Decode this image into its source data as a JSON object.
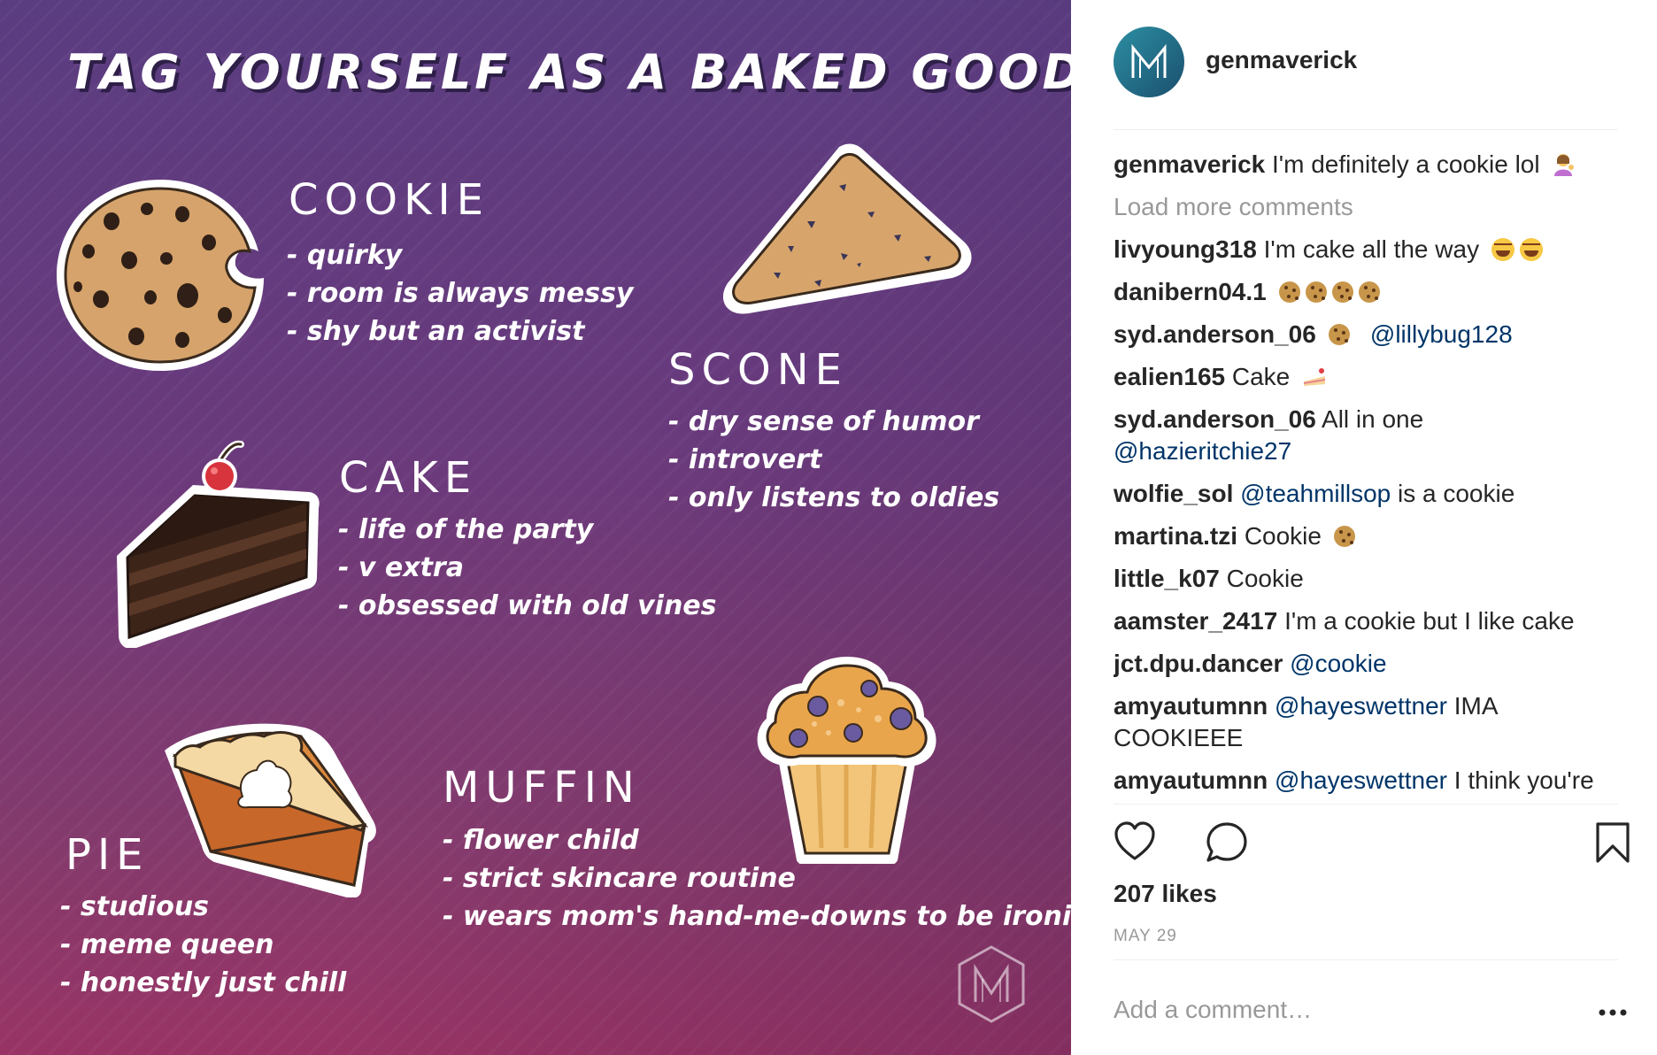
{
  "post": {
    "title": "TAG YOURSELF AS A BAKED GOOD",
    "goods": [
      {
        "name": "COOKIE",
        "traits": [
          "- quirky",
          "- room is always messy",
          "- shy but an activist"
        ]
      },
      {
        "name": "SCONE",
        "traits": [
          "- dry sense of humor",
          "- introvert",
          "- only listens to oldies"
        ]
      },
      {
        "name": "CAKE",
        "traits": [
          "- life of the party",
          "- v extra",
          "- obsessed with old vines"
        ]
      },
      {
        "name": "MUFFIN",
        "traits": [
          "- flower child",
          "- strict skincare routine",
          "- wears mom's hand-me-downs to be ironic"
        ]
      },
      {
        "name": "PIE",
        "traits": [
          "- studious",
          "- meme queen",
          "- honestly just chill"
        ]
      }
    ]
  },
  "header": {
    "username": "genmaverick",
    "avatar_icon": "maverick-logo-icon"
  },
  "caption": {
    "user": "genmaverick",
    "text": "I'm definitely a cookie lol",
    "emoji": "woman-tipping-hand-icon"
  },
  "load_more": "Load more comments",
  "comments": [
    {
      "user": "livyoung318",
      "text": "I'm cake all the way",
      "emoji": [
        "face-with-tears-of-joy-icon",
        "face-with-tears-of-joy-icon"
      ]
    },
    {
      "user": "danibern04.1",
      "text": "",
      "emoji": [
        "cookie-icon",
        "cookie-icon",
        "cookie-icon",
        "cookie-icon"
      ]
    },
    {
      "user": "syd.anderson_06",
      "emoji": [
        "cookie-icon"
      ],
      "mention": "@lillybug128"
    },
    {
      "user": "ealien165",
      "text": "Cake",
      "emoji": [
        "shortcake-icon"
      ]
    },
    {
      "user": "syd.anderson_06",
      "text": "All in one",
      "mention": "@hazieritchie27"
    },
    {
      "user": "wolfie_sol",
      "mention": "@teahmillsop",
      "text_after": "is a cookie"
    },
    {
      "user": "martina.tzi",
      "text": "Cookie",
      "emoji": [
        "cookie-icon"
      ]
    },
    {
      "user": "little_k07",
      "text": "Cookie"
    },
    {
      "user": "aamster_2417",
      "text": "I'm a cookie but I like cake"
    },
    {
      "user": "jct.dpu.dancer",
      "mention": "@cookie"
    },
    {
      "user": "amyautumnn",
      "mention": "@hayeswettner",
      "text_after": "IMA COOKIEEE"
    },
    {
      "user": "amyautumnn",
      "mention": "@hayeswettner",
      "text_after": "I think you're"
    }
  ],
  "likes": "207 likes",
  "date": "MAY 29",
  "add_comment_placeholder": "Add a comment…",
  "colors": {
    "mention": "#003569",
    "muted": "#999999",
    "text": "#262626",
    "poster_top": "#5a3c80",
    "poster_bottom": "#983465"
  }
}
